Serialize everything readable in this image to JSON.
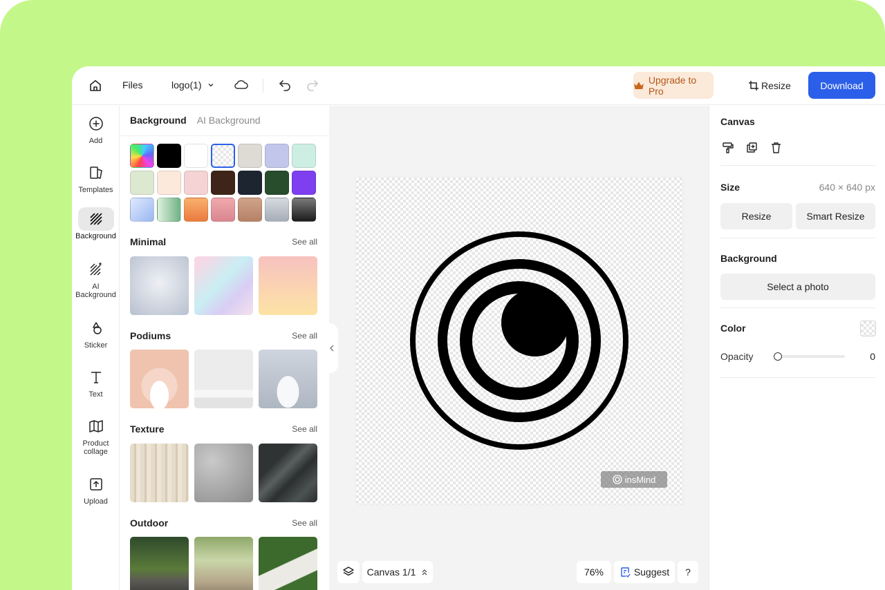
{
  "topbar": {
    "files_label": "Files",
    "file_name": "logo(1)",
    "upgrade_label": "Upgrade to Pro",
    "resize_label": "Resize",
    "download_label": "Download"
  },
  "rail": {
    "items": [
      {
        "label": "Add",
        "icon": "plus-circle-icon"
      },
      {
        "label": "Templates",
        "icon": "templates-icon"
      },
      {
        "label": "Background",
        "icon": "background-icon"
      },
      {
        "label": "AI Background",
        "icon": "ai-background-icon"
      },
      {
        "label": "Sticker",
        "icon": "sticker-icon"
      },
      {
        "label": "Text",
        "icon": "text-icon"
      },
      {
        "label": "Product collage",
        "icon": "collage-icon"
      },
      {
        "label": "Upload",
        "icon": "upload-icon"
      }
    ]
  },
  "panel": {
    "tab_active": "Background",
    "tab_other": "AI Background",
    "sections": [
      {
        "title": "Minimal",
        "see_all": "See all"
      },
      {
        "title": "Podiums",
        "see_all": "See all"
      },
      {
        "title": "Texture",
        "see_all": "See all"
      },
      {
        "title": "Outdoor",
        "see_all": "See all"
      }
    ],
    "swatch_colors": [
      "gradient-rainbow",
      "#000000",
      "#ffffff",
      "transparent",
      "#dedad4",
      "#c1c6ea",
      "#cdeee3",
      "#dde8d1",
      "#fde9db",
      "#f5d2d3",
      "#3f2519",
      "#1d2531",
      "#284d2d",
      "#7d3ff0",
      "gradient-blue",
      "gradient-green",
      "gradient-orange",
      "gradient-pink",
      "gradient-tan",
      "gradient-silver",
      "gradient-black"
    ]
  },
  "canvas": {
    "watermark": "insMind",
    "page_label": "Canvas 1/1",
    "zoom": "76%",
    "suggest_label": "Suggest",
    "help_label": "?"
  },
  "rpanel": {
    "title": "Canvas",
    "size_label": "Size",
    "size_value": "640 × 640 px",
    "resize_label": "Resize",
    "smart_resize_label": "Smart Resize",
    "background_label": "Background",
    "select_photo_label": "Select a photo",
    "color_label": "Color",
    "opacity_label": "Opacity",
    "opacity_value": "0"
  },
  "colors": {
    "accent": "#2c5fe9",
    "upgrade_bg": "#fbe9d9",
    "upgrade_text": "#b3581a",
    "frame_bg": "#c4f78a"
  }
}
